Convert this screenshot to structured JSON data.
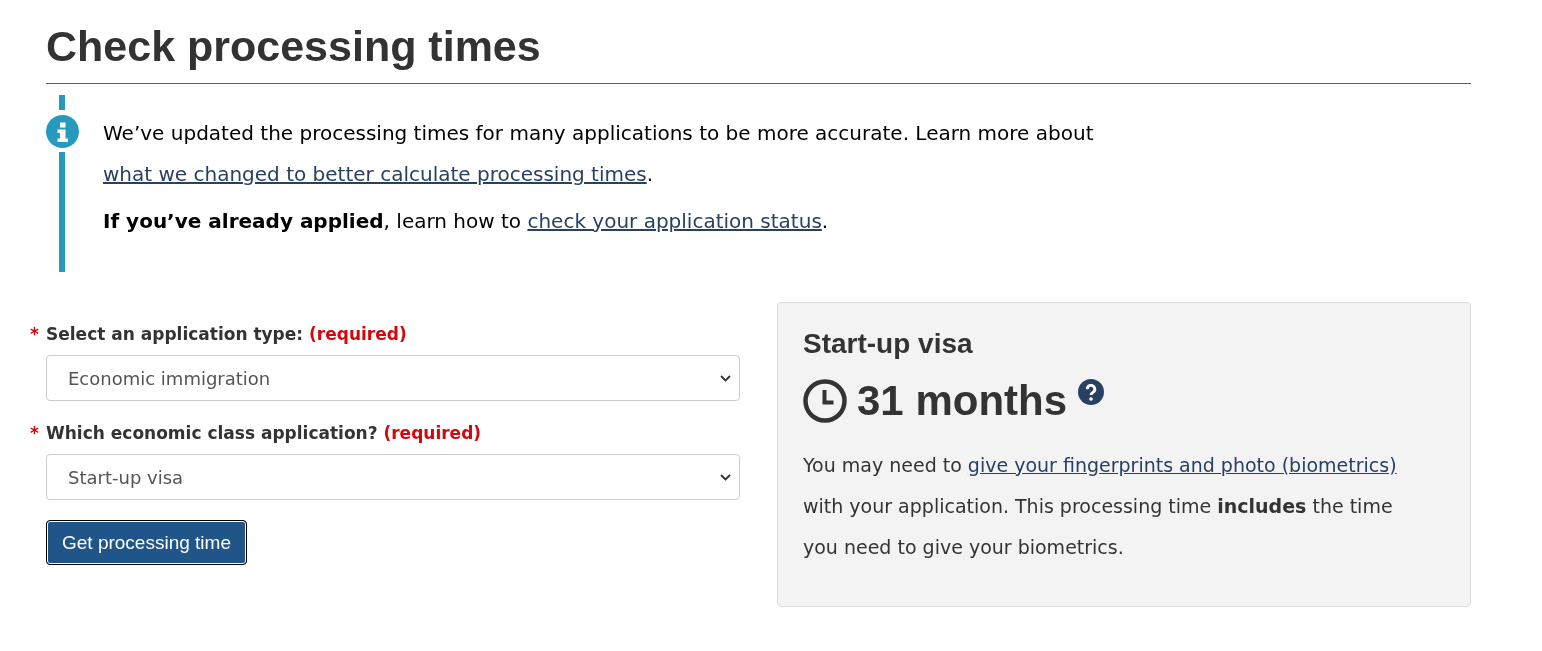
{
  "page": {
    "title": "Check processing times"
  },
  "notice": {
    "paragraphs": [
      [
        {
          "kind": "text",
          "text": "We’ve updated the processing times for many applications to be more accurate. Learn more about "
        },
        {
          "kind": "link",
          "text": "what we changed to better calculate processing times"
        },
        {
          "kind": "text",
          "text": "."
        }
      ],
      [
        {
          "kind": "text",
          "text": "**If you’ve already applied**, learn how to "
        },
        {
          "kind": "link",
          "text": "check your application status"
        },
        {
          "kind": "text",
          "text": "."
        }
      ]
    ]
  },
  "form": {
    "fields": [
      {
        "marker": "*",
        "label": "Select an application type:",
        "required": "(required)",
        "value": "Economic immigration"
      },
      {
        "marker": "*",
        "label": "Which economic class application?",
        "required": "(required)",
        "value": "Start-up visa"
      }
    ],
    "button": "Get processing time"
  },
  "result": {
    "heading": "Start-up visa",
    "duration": "31 months",
    "paragraph": [
      {
        "kind": "text",
        "text": "You may need to "
      },
      {
        "kind": "link",
        "text": "give your fingerprints and photo (biometrics)"
      },
      {
        "kind": "text",
        "text": " with your application. This processing time **includes** the time you need to give your biometrics."
      }
    ]
  }
}
